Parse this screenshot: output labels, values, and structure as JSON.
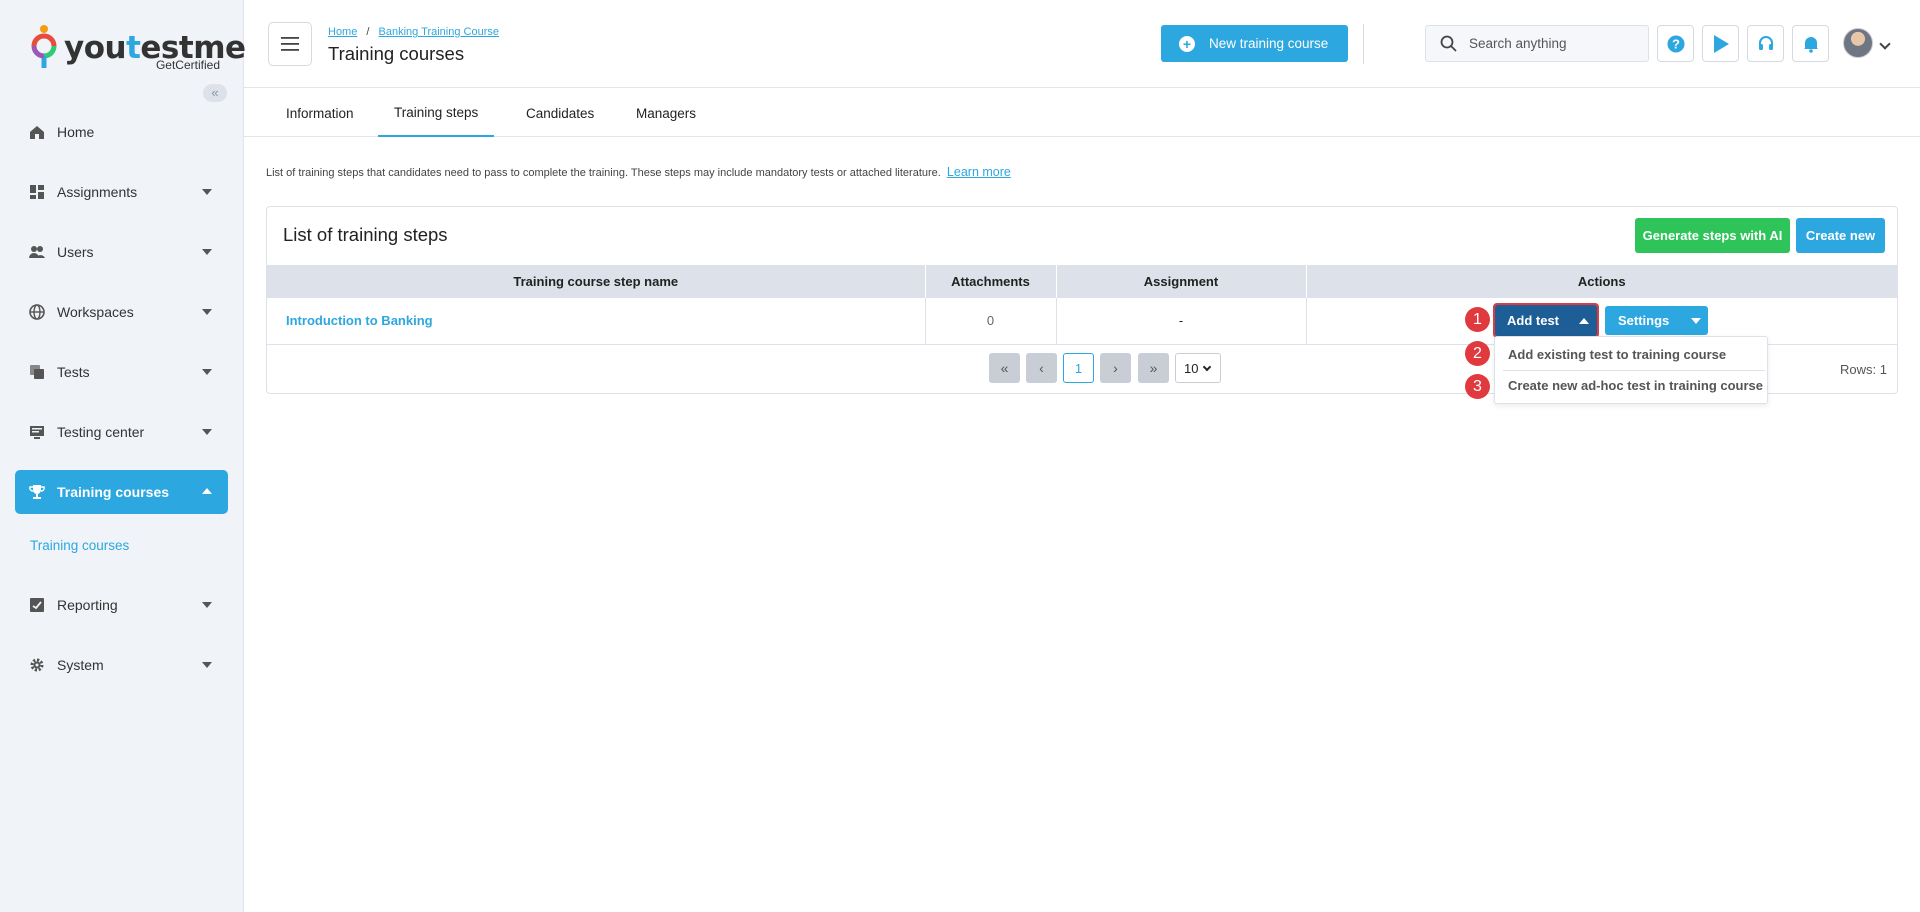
{
  "brand": {
    "logo_pre": "you",
    "logo_t": "t",
    "logo_post": "estme",
    "logo_sub": "GetCertified"
  },
  "sidebar": {
    "items": [
      {
        "label": "Home"
      },
      {
        "label": "Assignments"
      },
      {
        "label": "Users"
      },
      {
        "label": "Workspaces"
      },
      {
        "label": "Tests"
      },
      {
        "label": "Testing center"
      },
      {
        "label": "Training courses"
      },
      {
        "label": "Reporting"
      },
      {
        "label": "System"
      }
    ],
    "sub_item": "Training courses"
  },
  "header": {
    "breadcrumb": {
      "home": "Home",
      "separator": "/",
      "course": "Banking Training Course"
    },
    "title": "Training courses",
    "new_course_label": "New training course",
    "search_placeholder": "Search anything"
  },
  "tabs": [
    {
      "label": "Information"
    },
    {
      "label": "Training steps"
    },
    {
      "label": "Candidates"
    },
    {
      "label": "Managers"
    }
  ],
  "description": "List of training steps that candidates need to pass to complete the training. These steps may include mandatory tests or attached literature.",
  "learn_more": "Learn more",
  "card": {
    "title": "List of training steps",
    "generate_label": "Generate steps with AI",
    "create_label": "Create new",
    "columns": [
      "Training course step name",
      "Attachments",
      "Assignment",
      "Actions"
    ],
    "rows": [
      {
        "name": "Introduction to Banking",
        "attachments": "0",
        "assignment": "-"
      }
    ],
    "pager": {
      "current": "1",
      "page_size": "10",
      "rows_label": "Rows: 1"
    }
  },
  "actions": {
    "add_test_label": "Add test",
    "settings_label": "Settings",
    "menu": [
      "Add existing test to training course",
      "Create new ad-hoc test in training course"
    ],
    "markers": [
      "1",
      "2",
      "3"
    ]
  },
  "colors": {
    "accent": "#2ca7df",
    "green": "#2ec45a",
    "dark_blue": "#1e5e96",
    "marker": "#e0393e"
  }
}
